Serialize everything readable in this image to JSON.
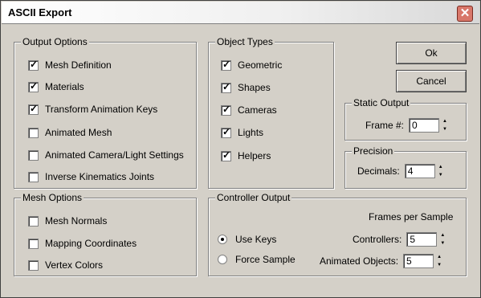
{
  "window": {
    "title": "ASCII Export",
    "close_glyph": "✕"
  },
  "output_options": {
    "legend": "Output Options",
    "items": [
      {
        "label": "Mesh Definition",
        "checked": true
      },
      {
        "label": "Materials",
        "checked": true
      },
      {
        "label": "Transform Animation Keys",
        "checked": true
      },
      {
        "label": "Animated Mesh",
        "checked": false
      },
      {
        "label": "Animated Camera/Light Settings",
        "checked": false
      },
      {
        "label": "Inverse Kinematics Joints",
        "checked": false
      }
    ]
  },
  "object_types": {
    "legend": "Object Types",
    "items": [
      {
        "label": "Geometric",
        "checked": true
      },
      {
        "label": "Shapes",
        "checked": true
      },
      {
        "label": "Cameras",
        "checked": true
      },
      {
        "label": "Lights",
        "checked": true
      },
      {
        "label": "Helpers",
        "checked": true
      }
    ]
  },
  "buttons": {
    "ok": "Ok",
    "cancel": "Cancel"
  },
  "static_output": {
    "legend": "Static Output",
    "frame_label": "Frame #:",
    "frame_value": "0"
  },
  "precision": {
    "legend": "Precision",
    "decimals_label": "Decimals:",
    "decimals_value": "4"
  },
  "mesh_options": {
    "legend": "Mesh Options",
    "items": [
      {
        "label": "Mesh Normals",
        "checked": false
      },
      {
        "label": "Mapping Coordinates",
        "checked": false
      },
      {
        "label": "Vertex Colors",
        "checked": false
      }
    ]
  },
  "controller_output": {
    "legend": "Controller Output",
    "frames_per_sample": "Frames per Sample",
    "radios": [
      {
        "label": "Use Keys",
        "selected": true
      },
      {
        "label": "Force Sample",
        "selected": false
      }
    ],
    "controllers_label": "Controllers:",
    "controllers_value": "5",
    "animated_objects_label": "Animated Objects:",
    "animated_objects_value": "5"
  }
}
